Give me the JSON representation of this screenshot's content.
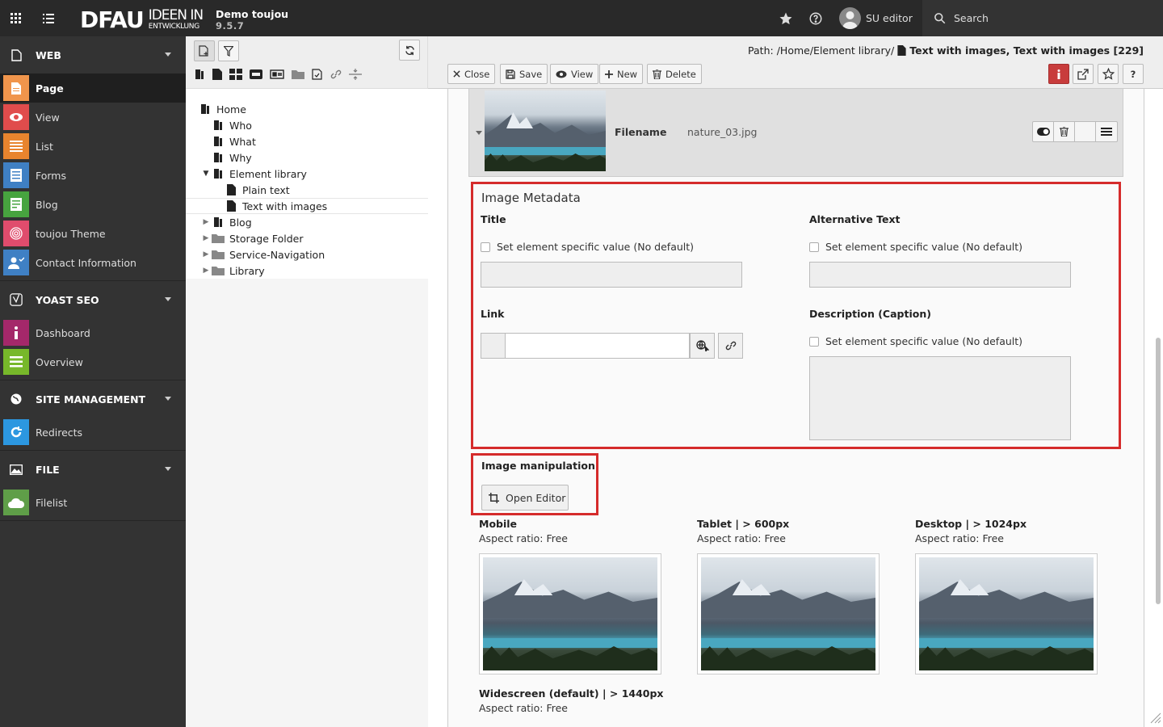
{
  "topbar": {
    "logo_main": "DFAU",
    "logo_line1": "IDEEN IN",
    "logo_line2": "ENTWICKLUNG",
    "site_name": "Demo toujou",
    "site_version": "9.5.7",
    "user_name": "SU editor",
    "search_label": "Search"
  },
  "sidebar": {
    "groups": [
      {
        "label": "WEB",
        "items": [
          {
            "label": "Page",
            "color": "#f0954c",
            "icon": "page-icon"
          },
          {
            "label": "View",
            "color": "#e04c4c",
            "icon": "eye-icon"
          },
          {
            "label": "List",
            "color": "#e8842e",
            "icon": "list-icon"
          },
          {
            "label": "Forms",
            "color": "#3f80c4",
            "icon": "forms-icon"
          },
          {
            "label": "Blog",
            "color": "#47a43f",
            "icon": "blog-icon"
          },
          {
            "label": "toujou Theme",
            "color": "#e04c6d",
            "icon": "fingerprint-icon"
          },
          {
            "label": "Contact Information",
            "color": "#3f80c4",
            "icon": "contact-icon"
          }
        ]
      },
      {
        "label": "YOAST SEO",
        "items": [
          {
            "label": "Dashboard",
            "color": "#a4286a",
            "icon": "info-icon"
          },
          {
            "label": "Overview",
            "color": "#77b82a",
            "icon": "overview-icon"
          }
        ]
      },
      {
        "label": "SITE MANAGEMENT",
        "items": [
          {
            "label": "Redirects",
            "color": "#2c97e0",
            "icon": "redirect-icon"
          }
        ]
      },
      {
        "label": "FILE",
        "items": [
          {
            "label": "Filelist",
            "color": "#5f9e48",
            "icon": "cloud-icon"
          }
        ]
      }
    ]
  },
  "tree": {
    "nodes": [
      {
        "label": "Home"
      },
      {
        "label": "Who"
      },
      {
        "label": "What"
      },
      {
        "label": "Why"
      },
      {
        "label": "Element library"
      },
      {
        "label": "Plain text"
      },
      {
        "label": "Text with images"
      },
      {
        "label": "Blog"
      },
      {
        "label": "Storage Folder"
      },
      {
        "label": "Service-Navigation"
      },
      {
        "label": "Library"
      }
    ]
  },
  "header": {
    "path_prefix": "Path:",
    "path_value": "/Home/Element library/",
    "record_title": "Text with images, Text with images [229]",
    "buttons": {
      "close": "Close",
      "save": "Save",
      "view": "View",
      "new": "New",
      "delete": "Delete"
    }
  },
  "file": {
    "filename_label": "Filename",
    "filename_value": "nature_03.jpg"
  },
  "metadata": {
    "title": "Image Metadata",
    "title_label": "Title",
    "alt_label": "Alternative Text",
    "link_label": "Link",
    "desc_label": "Description (Caption)",
    "checkbox_label": "Set element specific value (No default)"
  },
  "manipulation": {
    "title": "Image manipulation",
    "open_editor": "Open Editor"
  },
  "variants": [
    {
      "title": "Mobile",
      "aspect": "Aspect ratio: Free"
    },
    {
      "title": "Tablet | > 600px",
      "aspect": "Aspect ratio: Free"
    },
    {
      "title": "Desktop | > 1024px",
      "aspect": "Aspect ratio: Free"
    },
    {
      "title": "Widescreen (default) | > 1440px",
      "aspect": "Aspect ratio: Free"
    }
  ],
  "colors": {
    "highlight_border": "#d52b2b",
    "topbar": "#292929",
    "sidebar": "#333333"
  }
}
